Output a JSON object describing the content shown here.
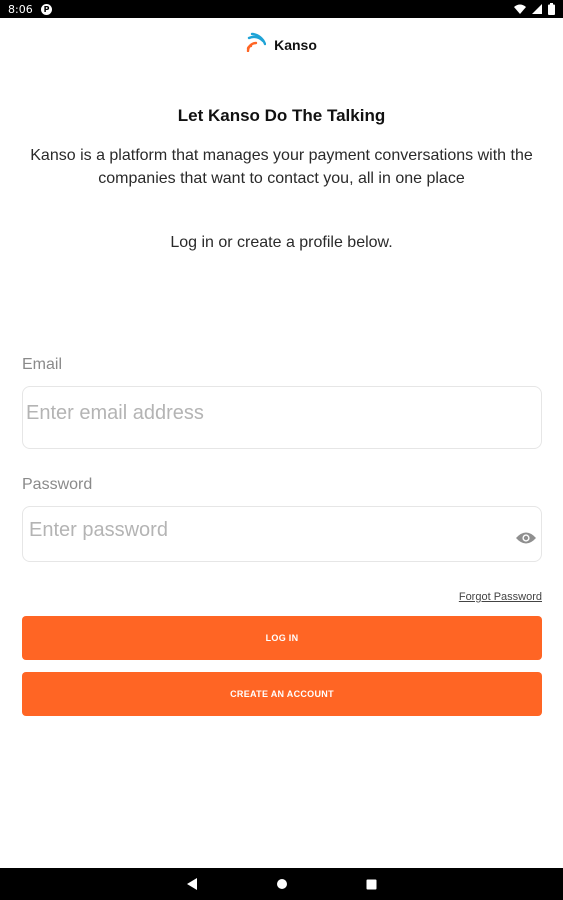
{
  "status_bar": {
    "time": "8:06",
    "icons": [
      "notification-app-icon",
      "wifi-icon",
      "signal-icon",
      "battery-icon"
    ]
  },
  "brand": {
    "name": "Kanso",
    "logo_icon": "kanso-signal-logo",
    "logo_colors": [
      "#ff6524",
      "#1fa3d6"
    ]
  },
  "intro": {
    "heading": "Let Kanso Do The Talking",
    "description": "Kanso is a platform that manages your payment conversations with the companies that want to contact you, all in one place",
    "instruction": "Log in or create a profile below."
  },
  "form": {
    "email": {
      "label": "Email",
      "placeholder": "Enter email address",
      "value": ""
    },
    "password": {
      "label": "Password",
      "placeholder": "Enter password",
      "value": "",
      "toggle_icon": "eye-icon"
    },
    "forgot_password": "Forgot Password",
    "login_label": "LOG IN",
    "create_label": "CREATE AN ACCOUNT"
  },
  "nav_bar": {
    "buttons": [
      "back-icon",
      "home-icon",
      "recents-icon"
    ]
  },
  "colors": {
    "accent": "#ff6524",
    "brand_blue": "#1fa3d6",
    "placeholder": "#b4b4b4",
    "label": "#8a8a8a"
  }
}
